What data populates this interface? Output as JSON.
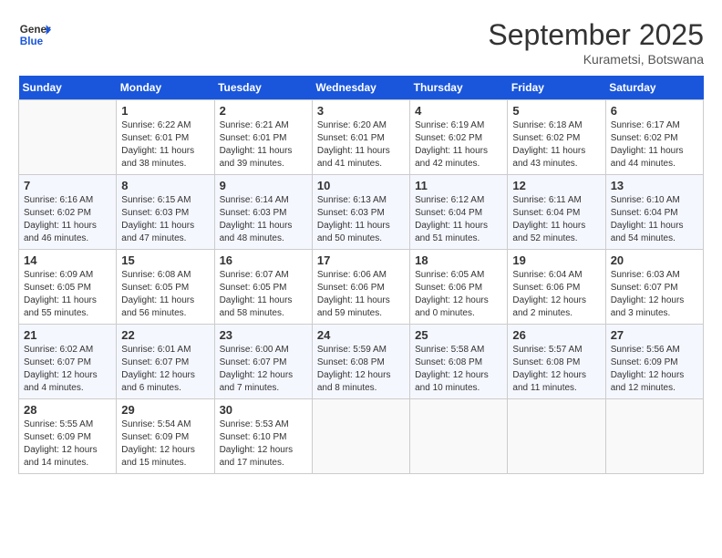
{
  "header": {
    "logo_line1": "General",
    "logo_line2": "Blue",
    "month": "September 2025",
    "location": "Kurametsi, Botswana"
  },
  "days_of_week": [
    "Sunday",
    "Monday",
    "Tuesday",
    "Wednesday",
    "Thursday",
    "Friday",
    "Saturday"
  ],
  "weeks": [
    [
      {
        "day": "",
        "info": ""
      },
      {
        "day": "1",
        "info": "Sunrise: 6:22 AM\nSunset: 6:01 PM\nDaylight: 11 hours\nand 38 minutes."
      },
      {
        "day": "2",
        "info": "Sunrise: 6:21 AM\nSunset: 6:01 PM\nDaylight: 11 hours\nand 39 minutes."
      },
      {
        "day": "3",
        "info": "Sunrise: 6:20 AM\nSunset: 6:01 PM\nDaylight: 11 hours\nand 41 minutes."
      },
      {
        "day": "4",
        "info": "Sunrise: 6:19 AM\nSunset: 6:02 PM\nDaylight: 11 hours\nand 42 minutes."
      },
      {
        "day": "5",
        "info": "Sunrise: 6:18 AM\nSunset: 6:02 PM\nDaylight: 11 hours\nand 43 minutes."
      },
      {
        "day": "6",
        "info": "Sunrise: 6:17 AM\nSunset: 6:02 PM\nDaylight: 11 hours\nand 44 minutes."
      }
    ],
    [
      {
        "day": "7",
        "info": "Sunrise: 6:16 AM\nSunset: 6:02 PM\nDaylight: 11 hours\nand 46 minutes."
      },
      {
        "day": "8",
        "info": "Sunrise: 6:15 AM\nSunset: 6:03 PM\nDaylight: 11 hours\nand 47 minutes."
      },
      {
        "day": "9",
        "info": "Sunrise: 6:14 AM\nSunset: 6:03 PM\nDaylight: 11 hours\nand 48 minutes."
      },
      {
        "day": "10",
        "info": "Sunrise: 6:13 AM\nSunset: 6:03 PM\nDaylight: 11 hours\nand 50 minutes."
      },
      {
        "day": "11",
        "info": "Sunrise: 6:12 AM\nSunset: 6:04 PM\nDaylight: 11 hours\nand 51 minutes."
      },
      {
        "day": "12",
        "info": "Sunrise: 6:11 AM\nSunset: 6:04 PM\nDaylight: 11 hours\nand 52 minutes."
      },
      {
        "day": "13",
        "info": "Sunrise: 6:10 AM\nSunset: 6:04 PM\nDaylight: 11 hours\nand 54 minutes."
      }
    ],
    [
      {
        "day": "14",
        "info": "Sunrise: 6:09 AM\nSunset: 6:05 PM\nDaylight: 11 hours\nand 55 minutes."
      },
      {
        "day": "15",
        "info": "Sunrise: 6:08 AM\nSunset: 6:05 PM\nDaylight: 11 hours\nand 56 minutes."
      },
      {
        "day": "16",
        "info": "Sunrise: 6:07 AM\nSunset: 6:05 PM\nDaylight: 11 hours\nand 58 minutes."
      },
      {
        "day": "17",
        "info": "Sunrise: 6:06 AM\nSunset: 6:06 PM\nDaylight: 11 hours\nand 59 minutes."
      },
      {
        "day": "18",
        "info": "Sunrise: 6:05 AM\nSunset: 6:06 PM\nDaylight: 12 hours\nand 0 minutes."
      },
      {
        "day": "19",
        "info": "Sunrise: 6:04 AM\nSunset: 6:06 PM\nDaylight: 12 hours\nand 2 minutes."
      },
      {
        "day": "20",
        "info": "Sunrise: 6:03 AM\nSunset: 6:07 PM\nDaylight: 12 hours\nand 3 minutes."
      }
    ],
    [
      {
        "day": "21",
        "info": "Sunrise: 6:02 AM\nSunset: 6:07 PM\nDaylight: 12 hours\nand 4 minutes."
      },
      {
        "day": "22",
        "info": "Sunrise: 6:01 AM\nSunset: 6:07 PM\nDaylight: 12 hours\nand 6 minutes."
      },
      {
        "day": "23",
        "info": "Sunrise: 6:00 AM\nSunset: 6:07 PM\nDaylight: 12 hours\nand 7 minutes."
      },
      {
        "day": "24",
        "info": "Sunrise: 5:59 AM\nSunset: 6:08 PM\nDaylight: 12 hours\nand 8 minutes."
      },
      {
        "day": "25",
        "info": "Sunrise: 5:58 AM\nSunset: 6:08 PM\nDaylight: 12 hours\nand 10 minutes."
      },
      {
        "day": "26",
        "info": "Sunrise: 5:57 AM\nSunset: 6:08 PM\nDaylight: 12 hours\nand 11 minutes."
      },
      {
        "day": "27",
        "info": "Sunrise: 5:56 AM\nSunset: 6:09 PM\nDaylight: 12 hours\nand 12 minutes."
      }
    ],
    [
      {
        "day": "28",
        "info": "Sunrise: 5:55 AM\nSunset: 6:09 PM\nDaylight: 12 hours\nand 14 minutes."
      },
      {
        "day": "29",
        "info": "Sunrise: 5:54 AM\nSunset: 6:09 PM\nDaylight: 12 hours\nand 15 minutes."
      },
      {
        "day": "30",
        "info": "Sunrise: 5:53 AM\nSunset: 6:10 PM\nDaylight: 12 hours\nand 17 minutes."
      },
      {
        "day": "",
        "info": ""
      },
      {
        "day": "",
        "info": ""
      },
      {
        "day": "",
        "info": ""
      },
      {
        "day": "",
        "info": ""
      }
    ]
  ]
}
